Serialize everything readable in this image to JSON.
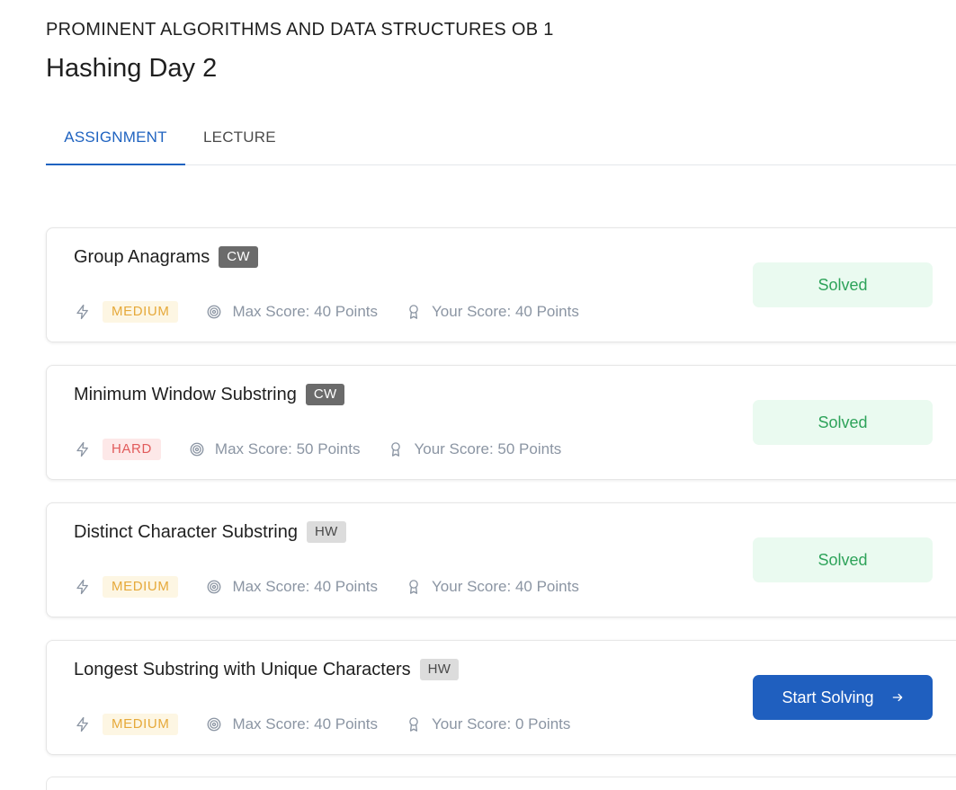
{
  "header": {
    "course_name": "PROMINENT ALGORITHMS AND DATA STRUCTURES OB 1",
    "lesson_title": "Hashing Day 2"
  },
  "tabs": [
    {
      "label": "ASSIGNMENT",
      "active": true
    },
    {
      "label": "LECTURE",
      "active": false
    }
  ],
  "colors": {
    "accent": "#1f63c0",
    "solved_bg": "#eafaf0",
    "solved_text": "#2ea35a",
    "medium_text": "#e6a93a",
    "hard_text": "#e15b5b",
    "button_bg": "#1f5fbf"
  },
  "icons": {
    "difficulty": "lightning-icon",
    "max_score": "target-icon",
    "your_score": "award-icon",
    "start": "arrow-right-icon"
  },
  "problems": [
    {
      "title": "Group Anagrams",
      "tag": "CW",
      "difficulty": "MEDIUM",
      "max_score": "Max Score: 40 Points",
      "your_score": "Your Score: 40 Points",
      "status": "Solved"
    },
    {
      "title": "Minimum Window Substring",
      "tag": "CW",
      "difficulty": "HARD",
      "max_score": "Max Score: 50 Points",
      "your_score": "Your Score: 50 Points",
      "status": "Solved"
    },
    {
      "title": "Distinct Character Substring",
      "tag": "HW",
      "difficulty": "MEDIUM",
      "max_score": "Max Score: 40 Points",
      "your_score": "Your Score: 40 Points",
      "status": "Solved"
    },
    {
      "title": "Longest Substring with Unique Characters",
      "tag": "HW",
      "difficulty": "MEDIUM",
      "max_score": "Max Score: 40 Points",
      "your_score": "Your Score: 0 Points",
      "status": "Start Solving"
    }
  ]
}
